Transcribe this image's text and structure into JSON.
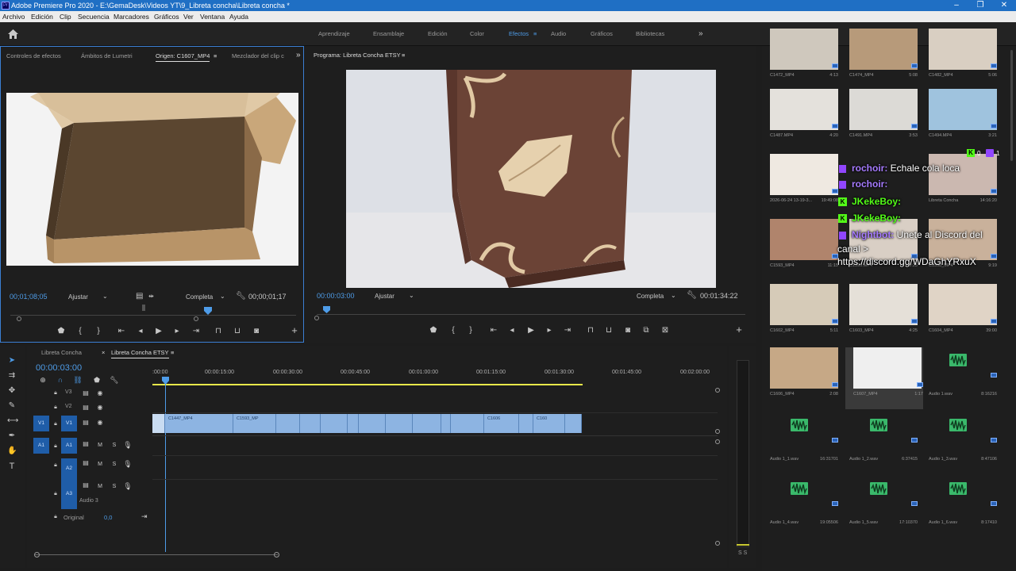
{
  "window": {
    "title": "Adobe Premiere Pro 2020 - E:\\GemaDesk\\Videos YT\\9_Libreta concha\\Libreta concha *"
  },
  "menu": [
    "Archivo",
    "Edición",
    "Clip",
    "Secuencia",
    "Marcadores",
    "Gráficos",
    "Ver",
    "Ventana",
    "Ayuda"
  ],
  "workspaces": [
    "Aprendizaje",
    "Ensamblaje",
    "Edición",
    "Color",
    "Efectos",
    "Audio",
    "Gráficos",
    "Bibliotecas"
  ],
  "active_workspace": "Efectos",
  "source_panel": {
    "tabs": [
      "Controles de efectos",
      "Ámbitos de Lumetri",
      "Origen: C1607_MP4",
      "Mezclador del clip c"
    ],
    "timecode_in": "00;01;08;05",
    "fit": "Ajustar",
    "quality": "Completa",
    "duration": "00;00;01;17"
  },
  "program_panel": {
    "title": "Programa: Libreta Concha ETSY",
    "timecode": "00:00:03:00",
    "fit": "Ajustar",
    "quality": "Completa",
    "duration": "00:01:34:22"
  },
  "timeline": {
    "tabs": [
      "Libreta Concha",
      "Libreta Concha ETSY"
    ],
    "timecode": "00:00:03:00",
    "ruler": [
      ":00:00",
      "00:00:15:00",
      "00:00:30:00",
      "00:00:45:00",
      "00:01:00:00",
      "00:01:15:00",
      "00:01:30:00",
      "00:01:45:00",
      "00:02:00:00"
    ],
    "video_tracks": [
      "V3",
      "V2",
      "V1"
    ],
    "audio_tracks": [
      "A1",
      "A2",
      "A3"
    ],
    "audio3_name": "Audio 3",
    "original_label": "Original",
    "original_value": "0,0",
    "clip_labels": [
      "C1447_MP4",
      "C1593_MP",
      "C1606",
      "C160"
    ],
    "track_letters": {
      "mute": "M",
      "solo": "S"
    }
  },
  "project": {
    "items": [
      {
        "name": "C1472_MP4",
        "dur": "4:13"
      },
      {
        "name": "C1474_MP4",
        "dur": "5:08"
      },
      {
        "name": "C1482_MP4",
        "dur": "5:06"
      },
      {
        "name": "C1487.MP4",
        "dur": "4:20"
      },
      {
        "name": "C1491.MP4",
        "dur": "3:53"
      },
      {
        "name": "C1494.MP4",
        "dur": "3:21"
      },
      {
        "name": "2026-06-24 13-19-3...",
        "dur": "19:49:08"
      },
      {
        "name": "",
        "dur": ""
      },
      {
        "name": "Libreta Concha",
        "dur": "14:16:20"
      },
      {
        "name": "C1593_MP4",
        "dur": "11:15"
      },
      {
        "name": "C1596.MP4",
        "dur": "9:23"
      },
      {
        "name": "C1598_MP4",
        "dur": "9:19"
      },
      {
        "name": "C1602_MP4",
        "dur": "5:11"
      },
      {
        "name": "C1603_MP4",
        "dur": "4:25"
      },
      {
        "name": "C1604_MP4",
        "dur": "39:00"
      },
      {
        "name": "C1606_MP4",
        "dur": "2:08"
      },
      {
        "name": "C1607_MP4",
        "dur": "1:17"
      },
      {
        "name": "Audio 1.wav",
        "dur": "8:16216"
      },
      {
        "name": "Audio 1_1.wav",
        "dur": "16:31701"
      },
      {
        "name": "Audio 1_2.wav",
        "dur": "6:37415"
      },
      {
        "name": "Audio 1_3.wav",
        "dur": "8:47106"
      },
      {
        "name": "Audio 1_4.wav",
        "dur": "19:05506"
      },
      {
        "name": "Audio 1_5.wav",
        "dur": "17:10370"
      },
      {
        "name": "Audio 1_6.wav",
        "dur": "8:17410"
      }
    ]
  },
  "chat": {
    "lines": [
      {
        "user": "rochoir:",
        "msg": " Echale cola loca"
      },
      {
        "user": "rochoir:",
        "msg": ""
      },
      {
        "user": "JKekeBoy:",
        "msg": ""
      },
      {
        "user": "JKekeBoy:",
        "msg": ""
      },
      {
        "user": "Nightbot:",
        "msg": " Unete al Discord del"
      },
      {
        "user": "",
        "msg": "canal >"
      },
      {
        "user": "",
        "msg": "https://discord.gg/WDaGhYRxuX"
      }
    ],
    "viewers_kick": "0",
    "viewers_twitch": "1"
  },
  "meter": {
    "labels": "S S"
  },
  "colors": {
    "accent": "#4e9ce8",
    "titlebar": "#1f6fc4",
    "clip": "#8db4e2",
    "audio_icon": "#3ab96b"
  }
}
